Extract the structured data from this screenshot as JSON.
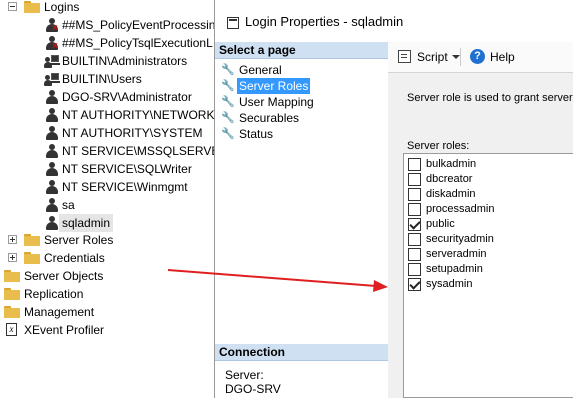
{
  "tree": {
    "logins_folder": "Logins",
    "logins": [
      {
        "label": "##MS_PolicyEventProcessin",
        "icon": "disabled-user-icon"
      },
      {
        "label": "##MS_PolicyTsqlExecutionL",
        "icon": "disabled-user-icon"
      },
      {
        "label": "BUILTIN\\Administrators",
        "icon": "windows-group-icon"
      },
      {
        "label": "BUILTIN\\Users",
        "icon": "windows-group-icon"
      },
      {
        "label": "DGO-SRV\\Administrator",
        "icon": "user-icon"
      },
      {
        "label": "NT AUTHORITY\\NETWORK",
        "icon": "user-icon"
      },
      {
        "label": "NT AUTHORITY\\SYSTEM",
        "icon": "user-icon"
      },
      {
        "label": "NT SERVICE\\MSSQLSERVER",
        "icon": "user-icon"
      },
      {
        "label": "NT SERVICE\\SQLWriter",
        "icon": "user-icon"
      },
      {
        "label": "NT SERVICE\\Winmgmt",
        "icon": "user-icon"
      },
      {
        "label": "sa",
        "icon": "user-icon"
      },
      {
        "label": "sqladmin",
        "icon": "user-icon"
      }
    ],
    "server_roles": "Server Roles",
    "credentials": "Credentials",
    "server_objects": "Server Objects",
    "replication": "Replication",
    "management": "Management",
    "xevent_profiler": "XEvent Profiler"
  },
  "dialog": {
    "title": "Login Properties - sqladmin",
    "select_page_header": "Select a page",
    "pages": [
      "General",
      "Server Roles",
      "User Mapping",
      "Securables",
      "Status"
    ],
    "active_page": "Server Roles",
    "connection_header": "Connection",
    "server_label": "Server:",
    "server_value": "DGO-SRV",
    "toolbar": {
      "script_label": "Script",
      "help_label": "Help"
    },
    "description": "Server role is used to grant server-w",
    "roles_label": "Server roles:",
    "roles": [
      {
        "name": "bulkadmin",
        "checked": false
      },
      {
        "name": "dbcreator",
        "checked": false
      },
      {
        "name": "diskadmin",
        "checked": false
      },
      {
        "name": "processadmin",
        "checked": false
      },
      {
        "name": "public",
        "checked": true
      },
      {
        "name": "securityadmin",
        "checked": false
      },
      {
        "name": "serveradmin",
        "checked": false
      },
      {
        "name": "setupadmin",
        "checked": false
      },
      {
        "name": "sysadmin",
        "checked": true
      }
    ]
  },
  "annotation": {
    "arrow_color": "#e02020"
  }
}
